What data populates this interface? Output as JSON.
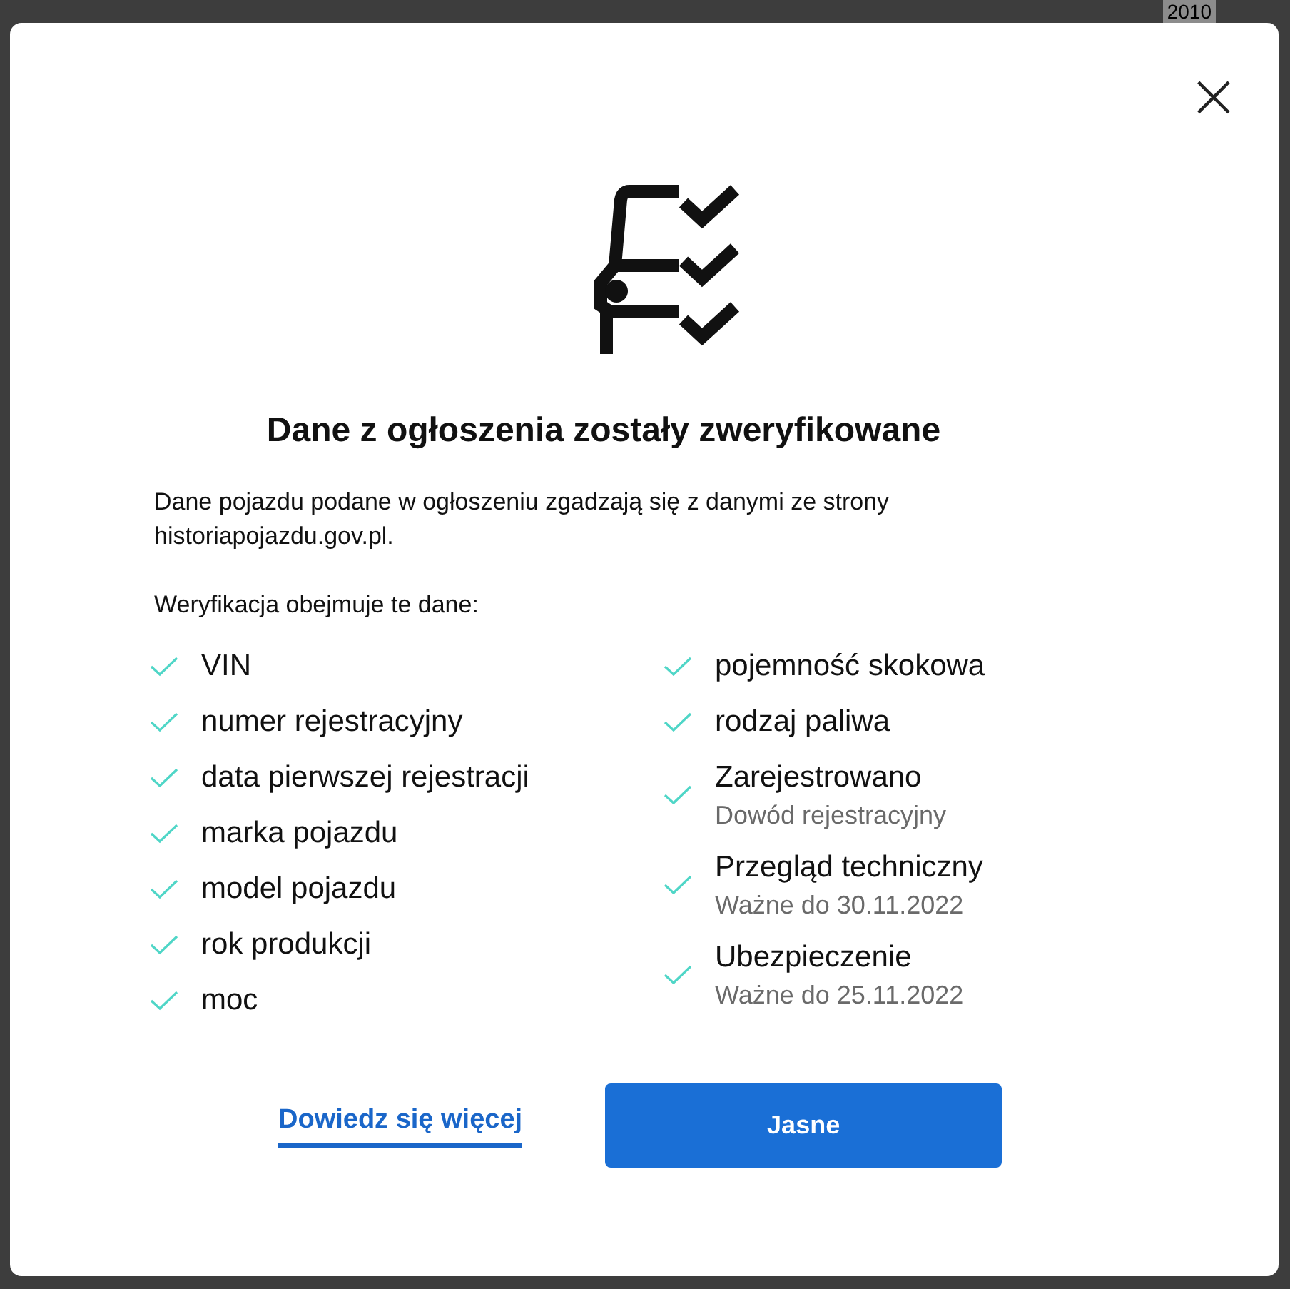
{
  "background": {
    "year": "2010"
  },
  "dialog": {
    "close_label": "×",
    "title": "Dane z ogłoszenia zostały zweryfikowane",
    "description": "Dane pojazdu podane w ogłoszeniu zgadzają się z danymi ze strony historiapojazdu.gov.pl.",
    "list_heading": "Weryfikacja obejmuje te dane:",
    "left_items": [
      {
        "label": "VIN"
      },
      {
        "label": "numer rejestracyjny"
      },
      {
        "label": "data pierwszej rejestracji"
      },
      {
        "label": "marka pojazdu"
      },
      {
        "label": "model pojazdu"
      },
      {
        "label": "rok produkcji"
      },
      {
        "label": "moc"
      }
    ],
    "right_items": [
      {
        "label": "pojemność skokowa"
      },
      {
        "label": "rodzaj paliwa"
      },
      {
        "label": "Zarejestrowano",
        "detail": "Dowód rejestracyjny"
      },
      {
        "label": "Przegląd techniczny",
        "detail": "Ważne do 30.11.2022"
      },
      {
        "label": "Ubezpieczenie",
        "detail": "Ważne do 25.11.2022"
      }
    ],
    "link": "Dowiedz się więcej",
    "button": "Jasne"
  }
}
